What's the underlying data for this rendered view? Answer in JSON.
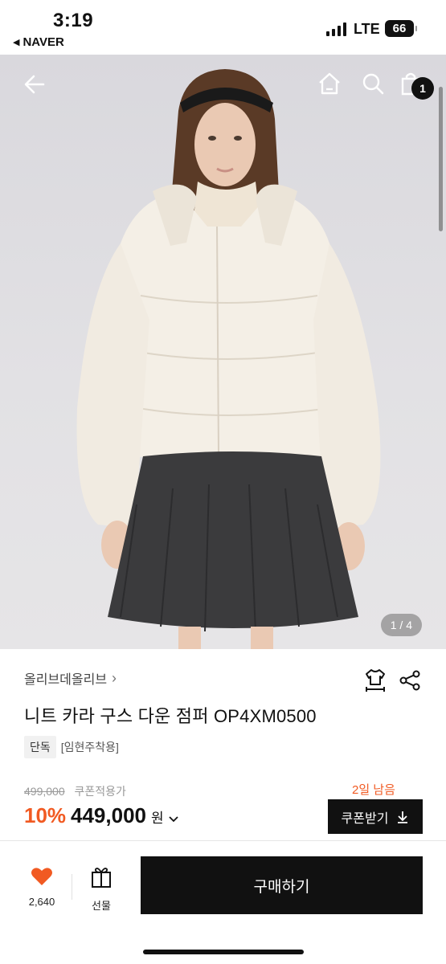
{
  "status_bar": {
    "time": "3:19",
    "back_app": "NAVER",
    "network": "LTE",
    "battery": "66"
  },
  "hero": {
    "pager": "1 / 4",
    "cart_count": "1",
    "icons": [
      "back-arrow-icon",
      "home-icon",
      "search-icon",
      "shopping-bag-icon"
    ]
  },
  "product": {
    "brand": "올리브데올리브",
    "title": "니트 카라 구스 다운 점퍼 OP4XM0500",
    "tags": [
      "단독",
      "[임현주착용]"
    ],
    "original_price": "499,000",
    "coupon_note": "쿠폰적용가",
    "discount": "10%",
    "price": "449,000",
    "price_unit": "원",
    "days_left": "2일 남음",
    "coupon_button": "쿠폰받기"
  },
  "bottom_bar": {
    "wish_count": "2,640",
    "gift_label": "선물",
    "buy_button": "구매하기"
  },
  "colors": {
    "accent": "#f15a22",
    "primary_button": "#111111"
  }
}
